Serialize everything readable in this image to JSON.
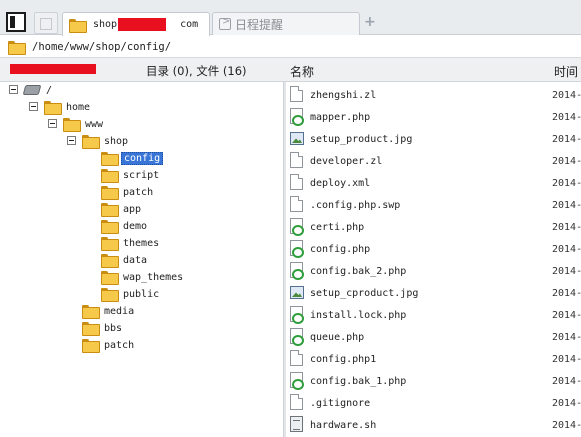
{
  "tabs": {
    "active_label": "shop",
    "active_suffix": " com",
    "inactive_label": "日程提醒",
    "add_label": "+"
  },
  "path": {
    "value": "/home/www/shop/config/"
  },
  "header": {
    "count_text": "目录 (0), 文件 (16)",
    "name_col": "名称",
    "time_col": "时间"
  },
  "tree": {
    "root": "/",
    "home": "home",
    "www": "www",
    "shop": "shop",
    "shop_children": [
      "config",
      "script",
      "patch",
      "app",
      "demo",
      "themes",
      "data",
      "wap_themes",
      "public"
    ],
    "www_children": [
      "media",
      "bbs",
      "patch"
    ]
  },
  "files": [
    {
      "name": "zhengshi.zl",
      "type": "doc",
      "date": "2014-"
    },
    {
      "name": "mapper.php",
      "type": "php",
      "date": "2014-"
    },
    {
      "name": "setup_product.jpg",
      "type": "img",
      "date": "2014-"
    },
    {
      "name": "developer.zl",
      "type": "doc",
      "date": "2014-"
    },
    {
      "name": "deploy.xml",
      "type": "doc",
      "date": "2014-"
    },
    {
      "name": ".config.php.swp",
      "type": "doc",
      "date": "2014-"
    },
    {
      "name": "certi.php",
      "type": "php",
      "date": "2014-"
    },
    {
      "name": "config.php",
      "type": "php",
      "date": "2014-"
    },
    {
      "name": "config.bak_2.php",
      "type": "php",
      "date": "2014-"
    },
    {
      "name": "setup_cproduct.jpg",
      "type": "img",
      "date": "2014-"
    },
    {
      "name": "install.lock.php",
      "type": "php",
      "date": "2014-"
    },
    {
      "name": "queue.php",
      "type": "php",
      "date": "2014-"
    },
    {
      "name": "config.php1",
      "type": "doc",
      "date": "2014-"
    },
    {
      "name": "config.bak_1.php",
      "type": "php",
      "date": "2014-"
    },
    {
      "name": ".gitignore",
      "type": "doc",
      "date": "2014-"
    },
    {
      "name": "hardware.sh",
      "type": "sh",
      "date": "2014-"
    }
  ],
  "colors": {
    "selection": "#3875d7",
    "redaction": "#e8101e",
    "folder": "#f6c94a"
  }
}
